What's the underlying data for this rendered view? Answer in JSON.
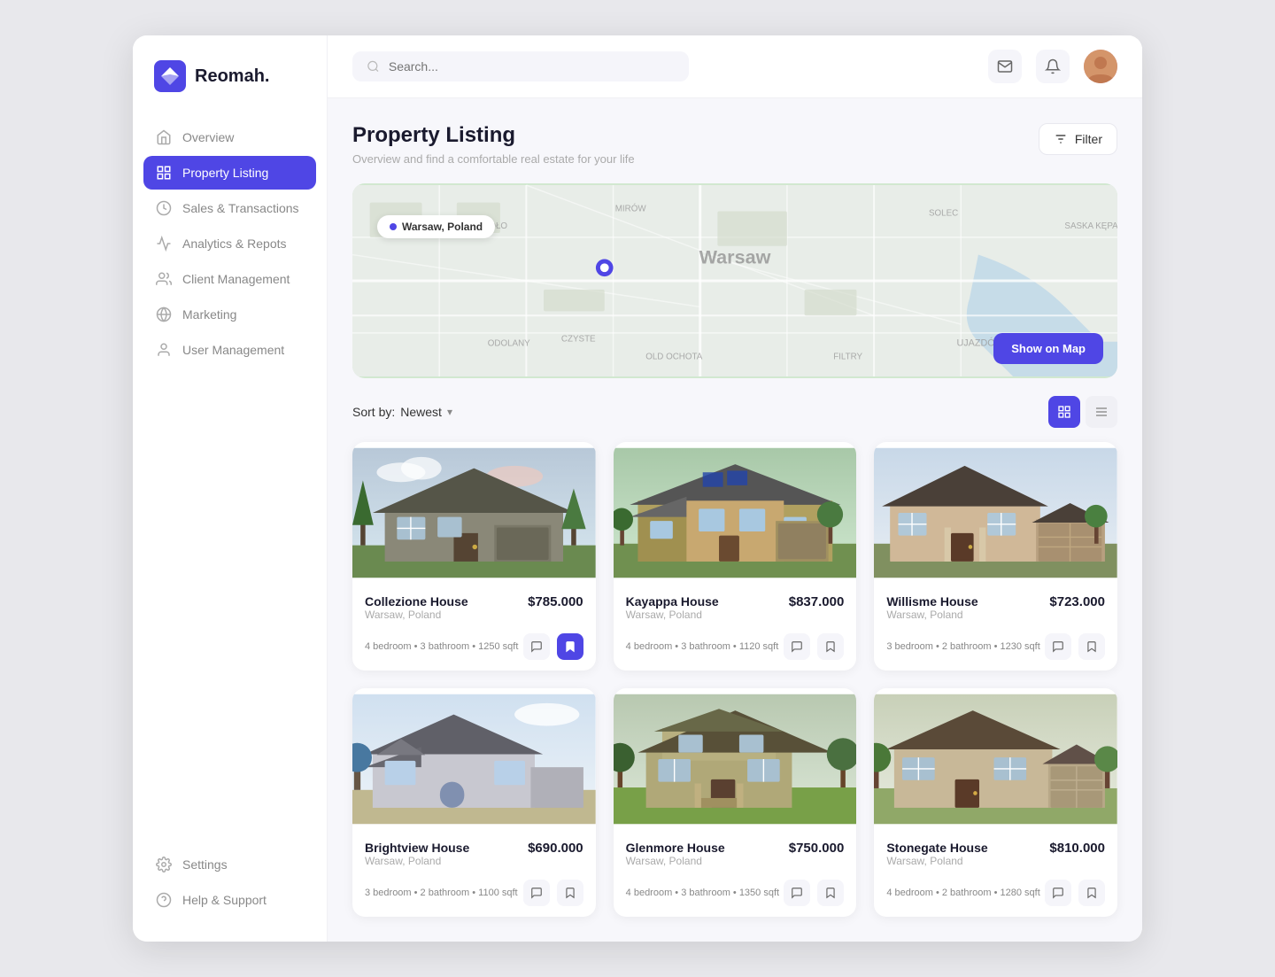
{
  "app": {
    "name": "Reomah."
  },
  "header": {
    "search_placeholder": "Search...",
    "filter_label": "Filter"
  },
  "sidebar": {
    "nav_items": [
      {
        "id": "overview",
        "label": "Overview",
        "active": false
      },
      {
        "id": "property-listing",
        "label": "Property Listing",
        "active": true
      },
      {
        "id": "sales-transactions",
        "label": "Sales & Transactions",
        "active": false
      },
      {
        "id": "analytics-reports",
        "label": "Analytics & Repots",
        "active": false
      },
      {
        "id": "client-management",
        "label": "Client Management",
        "active": false
      },
      {
        "id": "marketing",
        "label": "Marketing",
        "active": false
      },
      {
        "id": "user-management",
        "label": "User Management",
        "active": false
      }
    ],
    "bottom_items": [
      {
        "id": "settings",
        "label": "Settings"
      },
      {
        "id": "help-support",
        "label": "Help & Support"
      }
    ]
  },
  "page": {
    "title": "Property Listing",
    "subtitle": "Overview and find a comfortable real estate for your life"
  },
  "map": {
    "location_label": "Warsaw, Poland",
    "show_on_map_label": "Show on Map"
  },
  "sort": {
    "label": "Sort by:",
    "value": "Newest"
  },
  "properties": [
    {
      "id": 1,
      "name": "Collezione House",
      "location": "Warsaw, Poland",
      "price": "$785.000",
      "details": "4 bedroom • 3 bathroom • 1250 sqft",
      "color1": "#8a9ab5",
      "color2": "#6b7d96"
    },
    {
      "id": 2,
      "name": "Kayappa House",
      "location": "Warsaw, Poland",
      "price": "$837.000",
      "details": "4 bedroom • 3 bathroom • 1120 sqft",
      "color1": "#b5a080",
      "color2": "#8a7060"
    },
    {
      "id": 3,
      "name": "Willisme House",
      "location": "Warsaw, Poland",
      "price": "$723.000",
      "details": "3 bedroom • 2 bathroom • 1230 sqft",
      "color1": "#c0a888",
      "color2": "#987060"
    },
    {
      "id": 4,
      "name": "Brightview House",
      "location": "Warsaw, Poland",
      "price": "$690.000",
      "details": "3 bedroom • 2 bathroom • 1100 sqft",
      "color1": "#b0c4d8",
      "color2": "#8090a8"
    },
    {
      "id": 5,
      "name": "Glenmore House",
      "location": "Warsaw, Poland",
      "price": "$750.000",
      "details": "4 bedroom • 3 bathroom • 1350 sqft",
      "color1": "#a0b090",
      "color2": "#708060"
    },
    {
      "id": 6,
      "name": "Stonegate House",
      "location": "Warsaw, Poland",
      "price": "$810.000",
      "details": "4 bedroom • 2 bathroom • 1280 sqft",
      "color1": "#c8b898",
      "color2": "#a09070"
    }
  ]
}
